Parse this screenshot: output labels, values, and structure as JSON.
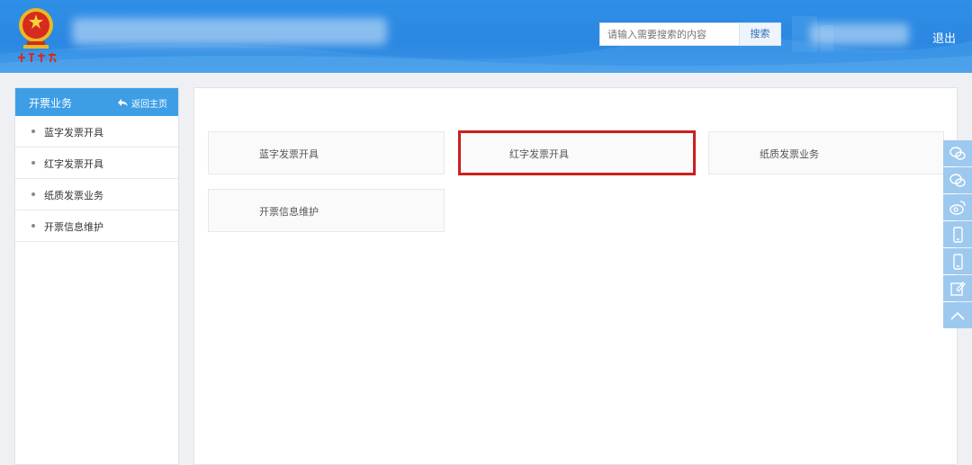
{
  "header": {
    "search_placeholder": "请输入需要搜索的内容",
    "search_button": "搜索",
    "logout": "退出"
  },
  "sidebar": {
    "title": "开票业务",
    "back_home": "返回主页",
    "items": [
      {
        "label": "蓝字发票开具"
      },
      {
        "label": "红字发票开具"
      },
      {
        "label": "纸质发票业务"
      },
      {
        "label": "开票信息维护"
      }
    ]
  },
  "main": {
    "cards": [
      {
        "label": "蓝字发票开具",
        "highlighted": false
      },
      {
        "label": "红字发票开具",
        "highlighted": true
      },
      {
        "label": "纸质发票业务",
        "highlighted": false
      },
      {
        "label": "开票信息维护",
        "highlighted": false
      }
    ]
  },
  "rightbar": {
    "icons": [
      "wechat-icon",
      "wechat-icon",
      "weibo-icon",
      "mobile-icon",
      "mobile-icon",
      "edit-icon",
      "back-to-top-icon"
    ]
  },
  "colors": {
    "header_blue": "#2b87e1",
    "sidebar_head": "#3d9ee6",
    "highlight_red": "#cc1f1f",
    "rightbar_blue": "#9ec9ef"
  }
}
